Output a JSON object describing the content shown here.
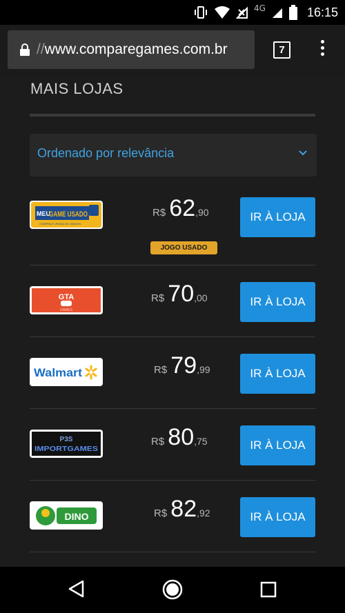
{
  "status_bar": {
    "network": "4G",
    "time": "16:15"
  },
  "browser": {
    "url_prefix": "//",
    "url": "www.comparegames.com.br",
    "tab_count": "7"
  },
  "section_title": "MAIS LOJAS",
  "sort": {
    "label": "Ordenado por relevância"
  },
  "stores": [
    {
      "logo": "MeuGameUsado",
      "logo_line1": "MEU",
      "logo_line2": "GAME USADO",
      "logo_tagline": "COMPRA E VENDA DE USADOS",
      "currency": "R$",
      "price_int": "62",
      "price_cents": ",90",
      "badge": "JOGO USADO",
      "button": "IR À LOJA"
    },
    {
      "logo": "GTA",
      "logo_line1": "GTA",
      "logo_tagline": "GAMES",
      "currency": "R$",
      "price_int": "70",
      "price_cents": ",00",
      "button": "IR À LOJA"
    },
    {
      "logo": "Walmart",
      "logo_line1": "Walmart",
      "currency": "R$",
      "price_int": "79",
      "price_cents": ",99",
      "button": "IR À LOJA"
    },
    {
      "logo": "P3S ImportGames",
      "logo_line1": "P3S",
      "logo_line2": "IMPORTGAMES",
      "currency": "R$",
      "price_int": "80",
      "price_cents": ",75",
      "button": "IR À LOJA"
    },
    {
      "logo": "Dino",
      "logo_line1": "DINO",
      "currency": "R$",
      "price_int": "82",
      "price_cents": ",92",
      "button": "IR À LOJA"
    }
  ],
  "colors": {
    "accent": "#1e8fdc",
    "link": "#3fa3e2",
    "badge": "#e2a52a",
    "background": "#1c1c1c"
  }
}
